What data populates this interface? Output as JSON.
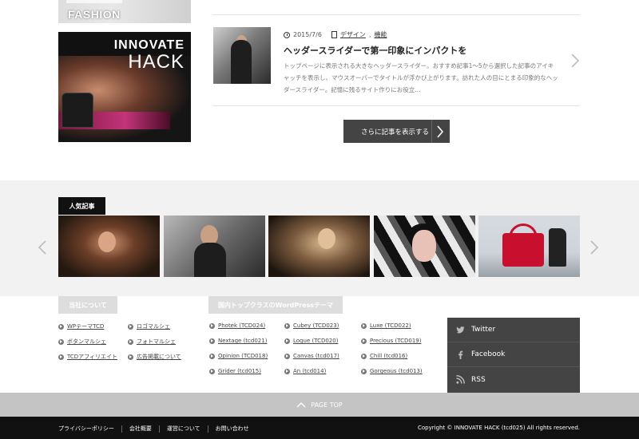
{
  "sidebar_banners": {
    "fashion_text": "FASHION",
    "innovate_line1": "INNOVATE",
    "innovate_line2": "HACK"
  },
  "post": {
    "date": "2015/7/6",
    "categories": [
      "デザイン",
      "機能"
    ],
    "title": "ヘッダースライダーで第一印象にインパクトを",
    "excerpt": "トップページに表示される大きなヘッダースライダー。おすすめ記事1～5から選択した記事のアイキャッチを表示し、マウスオーバーでタイトルが浮かび上がります。訪れた人の目にとまる印象的なヘッダースライダー。記憶に残るサイト作りにお役立..."
  },
  "more_button": {
    "label": "さらに記事を表示する"
  },
  "popular": {
    "label": "人気記事"
  },
  "widgets": {
    "about_title": "当社について",
    "about_links_col1": [
      "WPテーマTCD",
      "ボタンマルシェ",
      "TCDアフィリエイト"
    ],
    "about_links_col2": [
      "ロゴマルシェ",
      "フォトマルシェ",
      "広告掲載について"
    ],
    "themes_title": "国内トップクラスのWordPressテーマ",
    "themes_col1": [
      "Photek (TCD024)",
      "Nextage (tcd021)",
      "Opinion (TCD018)",
      "Grider (tcd015)"
    ],
    "themes_col2": [
      "Cubey (TCD023)",
      "Logue (TCD020)",
      "Canvas (tcd017)",
      "An (tcd014)"
    ],
    "themes_col3": [
      "Luxe (TCD022)",
      "Precious (TCD019)",
      "Chill (tcd016)",
      "Gorgeous (tcd013)"
    ]
  },
  "social": {
    "twitter": "Twitter",
    "facebook": "Facebook",
    "rss": "RSS"
  },
  "pagetop": {
    "label": "PAGE TOP"
  },
  "footer": {
    "nav": [
      "プライバシーポリシー",
      "会社概要",
      "運営について",
      "お問い合わせ"
    ],
    "copyright": "Copyright ©  INNOVATE HACK (tcd025) All rights reserved."
  }
}
